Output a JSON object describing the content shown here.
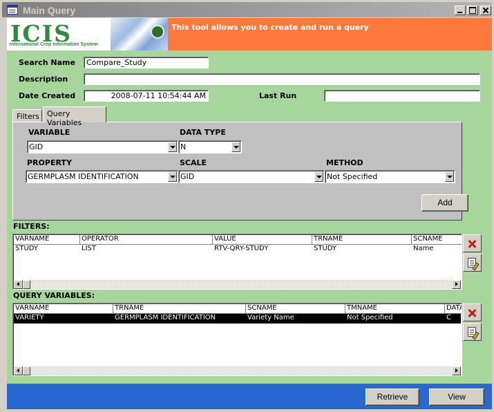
{
  "window": {
    "title": "Main Query"
  },
  "header": {
    "logo_text": "ICIS",
    "logo_subtitle": "International Crop Information System",
    "message": "This tool allows you to create and run a query"
  },
  "form": {
    "search_name_label": "Search Name",
    "search_name_value": "Compare_Study",
    "description_label": "Description",
    "description_value": "",
    "date_created_label": "Date Created",
    "date_created_value": "2008-07-11 10:54:44 AM",
    "last_run_label": "Last Run",
    "last_run_value": ""
  },
  "tabs": [
    {
      "label": "Filters",
      "active": false
    },
    {
      "label": "Query Variables",
      "active": true
    }
  ],
  "query_variables_tab": {
    "variable_label": "VARIABLE",
    "variable_value": "GID",
    "data_type_label": "DATA TYPE",
    "data_type_value": "N",
    "property_label": "PROPERTY",
    "property_value": "GERMPLASM IDENTIFICATION",
    "scale_label": "SCALE",
    "scale_value": "GID",
    "method_label": "METHOD",
    "method_value": "Not Specified",
    "add_button": "Add"
  },
  "filters_section": {
    "label": "FILTERS:",
    "columns": [
      "VARNAME",
      "OPERATOR",
      "VALUE",
      "TRNAME",
      "SCNAME"
    ],
    "rows": [
      [
        "STUDY",
        "LIST",
        "RTV-QRY-STUDY",
        "STUDY",
        "Name"
      ]
    ]
  },
  "query_variables_section": {
    "label": "QUERY VARIABLES:",
    "columns": [
      "VARNAME",
      "TRNAME",
      "SCNAME",
      "TMNAME",
      "DATA"
    ],
    "rows": [
      [
        "VARIETY",
        "GERMPLASM IDENTIFICATION",
        "Variety Name",
        "Not Specified",
        "C"
      ]
    ]
  },
  "footer": {
    "retrieve_button": "Retrieve",
    "view_button": "View"
  },
  "colors": {
    "header_orange": "#fd7a3c",
    "body_green": "#a7d69c",
    "footer_blue": "#2967d1",
    "logo_green": "#2f8a3e"
  }
}
